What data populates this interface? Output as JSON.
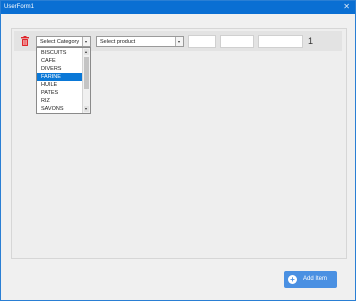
{
  "window": {
    "title": "UserForm1",
    "close_glyph": "✕"
  },
  "row": {
    "category_select": {
      "value": "Select Category"
    },
    "product_select": {
      "value": "Select product"
    },
    "count": "1"
  },
  "dropdown": {
    "options": [
      "BISCUITS",
      "CAFE",
      "DIVERS",
      "FARINE",
      "HUILE",
      "PATES",
      "RIZ",
      "SAVONS"
    ],
    "selected": "FARINE"
  },
  "add_button": {
    "label": "Add Item",
    "icon": "plus-icon"
  },
  "colors": {
    "titlebar": "#0a6fd3",
    "accent": "#0a78d7",
    "button": "#4a90e2",
    "trash": "#e0262b"
  }
}
